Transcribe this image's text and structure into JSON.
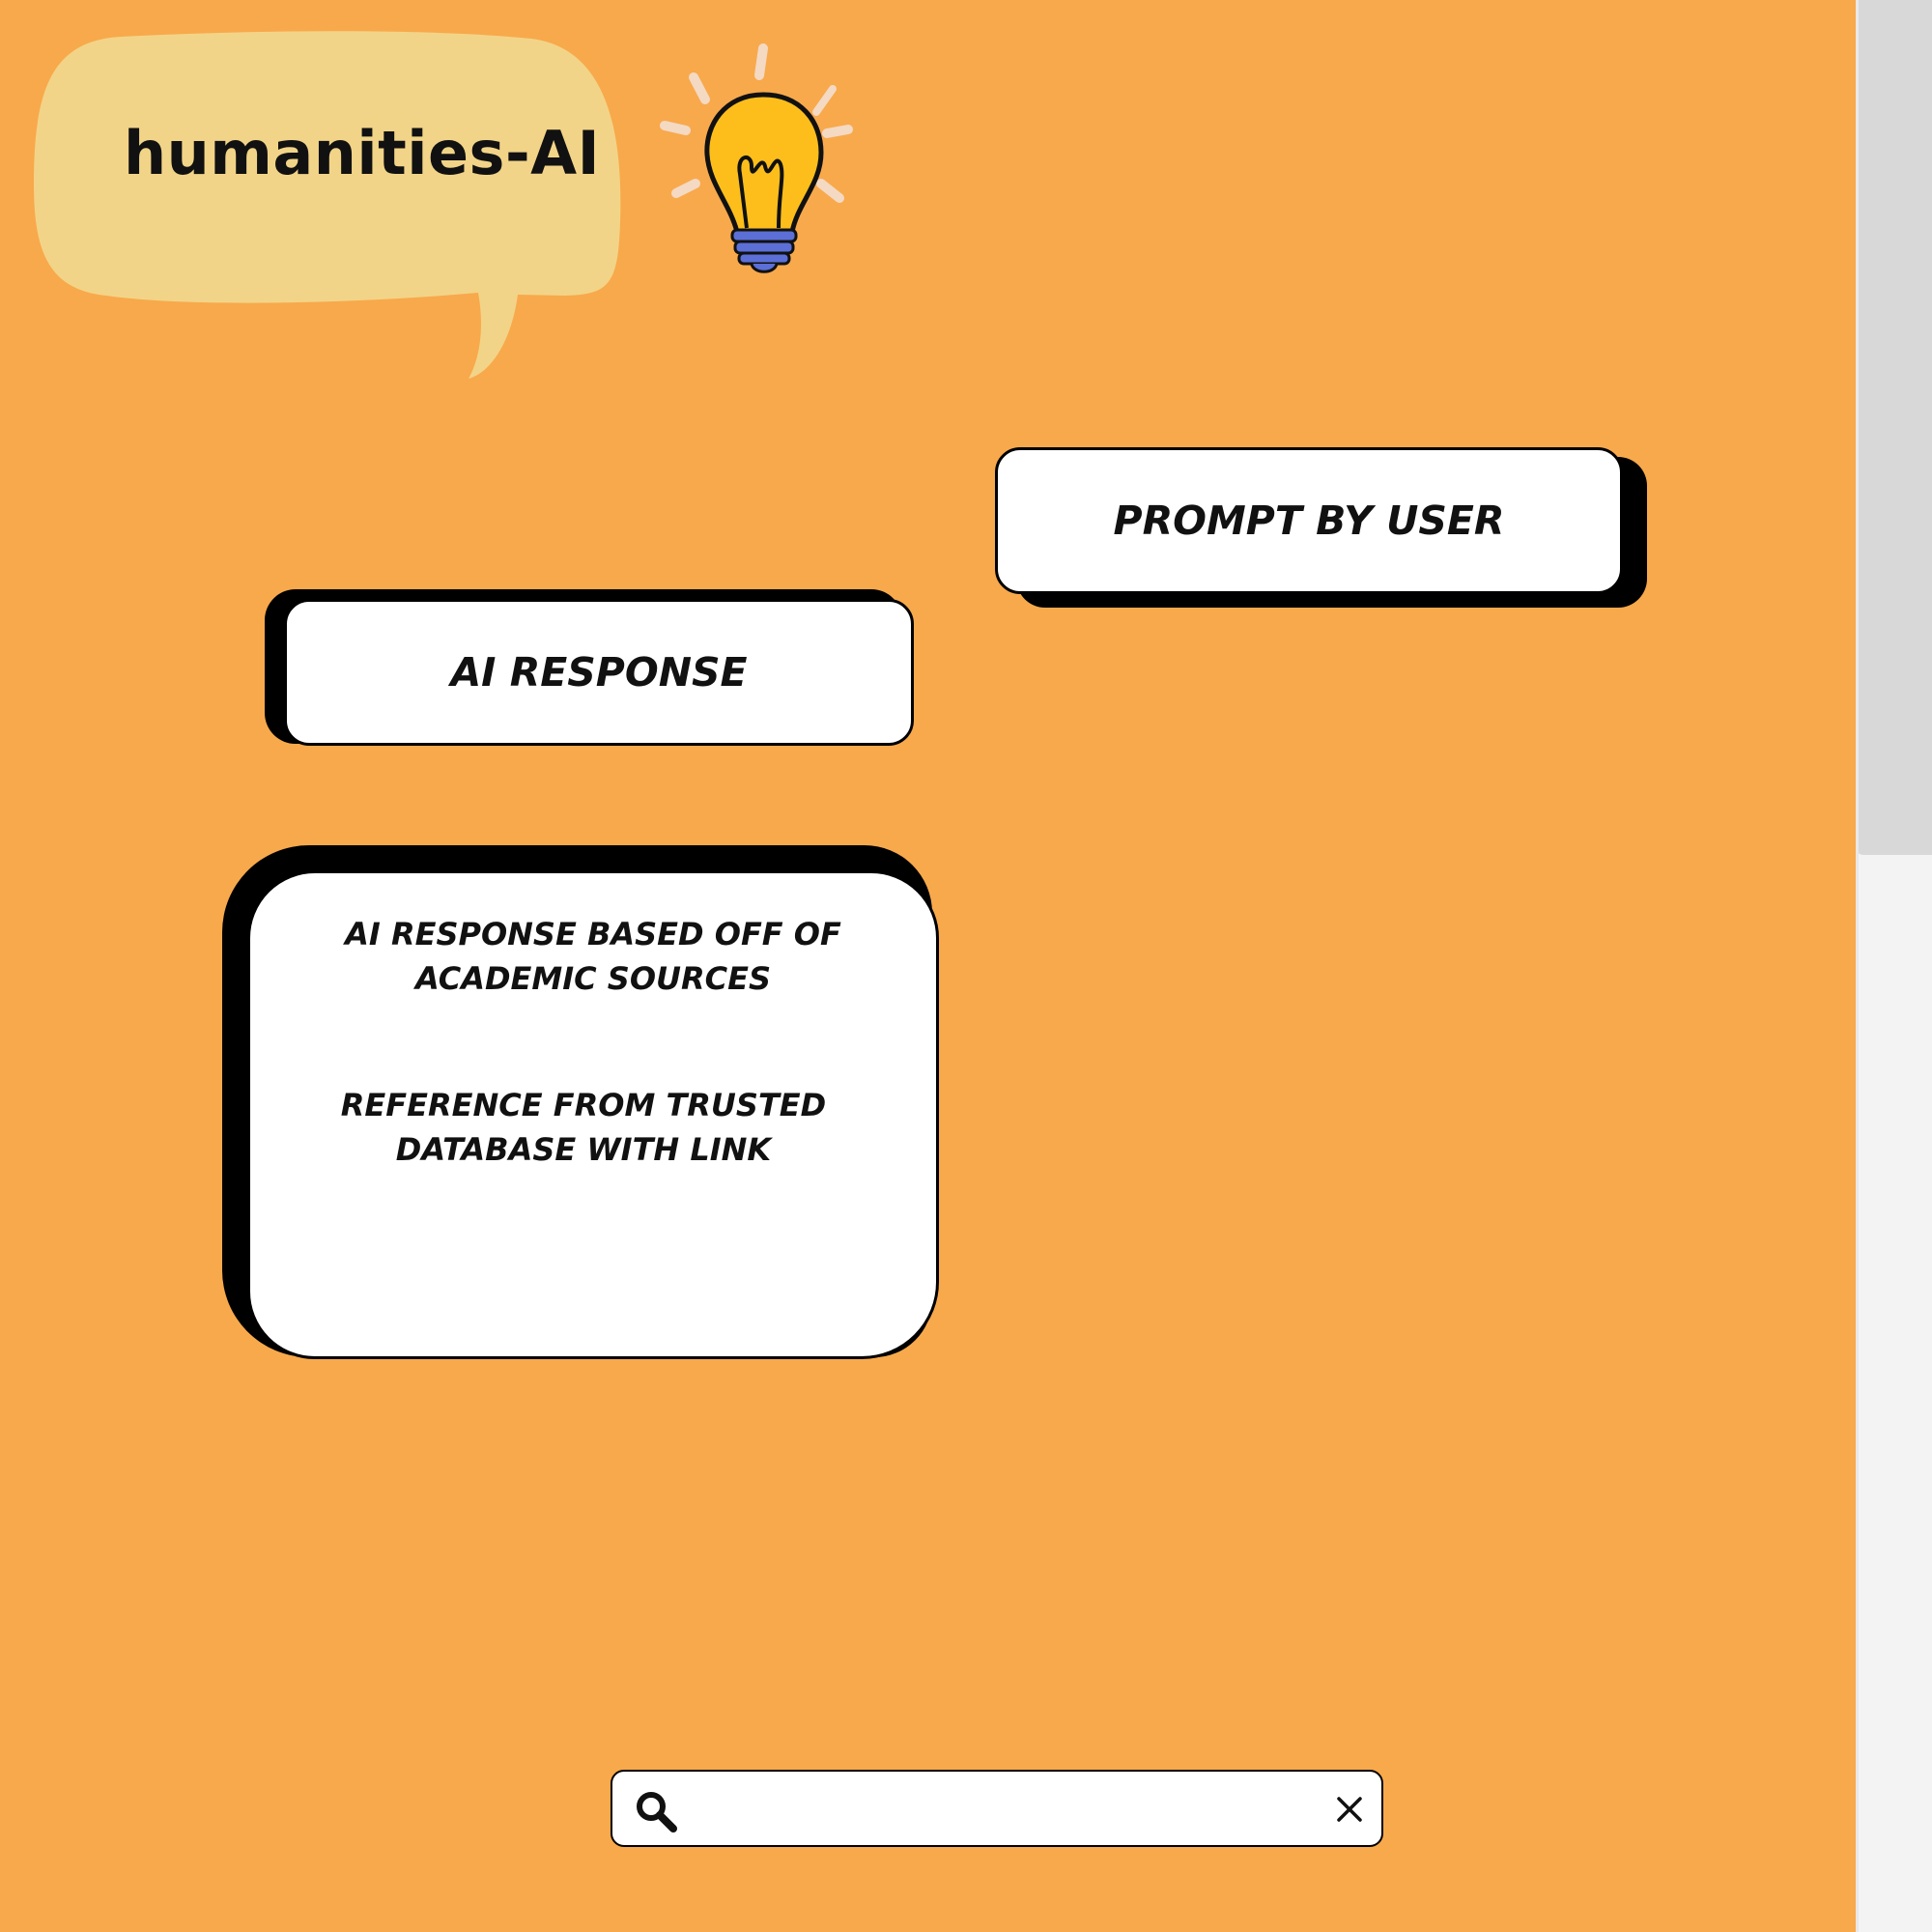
{
  "app": {
    "title": "humanities-AI"
  },
  "chat": {
    "prompt_label": "PROMPT BY USER",
    "response_label": "AI RESPONSE",
    "source_response_text": "AI RESPONSE BASED OFF OF ACADEMIC SOURCES",
    "reference_text": "REFERENCE FROM TRUSTED DATABASE WITH LINK"
  },
  "search": {
    "value": "",
    "placeholder": ""
  },
  "icons": {
    "logo": "lightbulb-icon",
    "search": "search-icon",
    "clear": "close-icon"
  },
  "colors": {
    "background": "#F8A94B",
    "bubble": "#F2D488",
    "bulb": "#FDBE1B",
    "bulb_base": "#5B6FD6",
    "card": "#FFFFFF",
    "card_shadow": "#000000"
  }
}
